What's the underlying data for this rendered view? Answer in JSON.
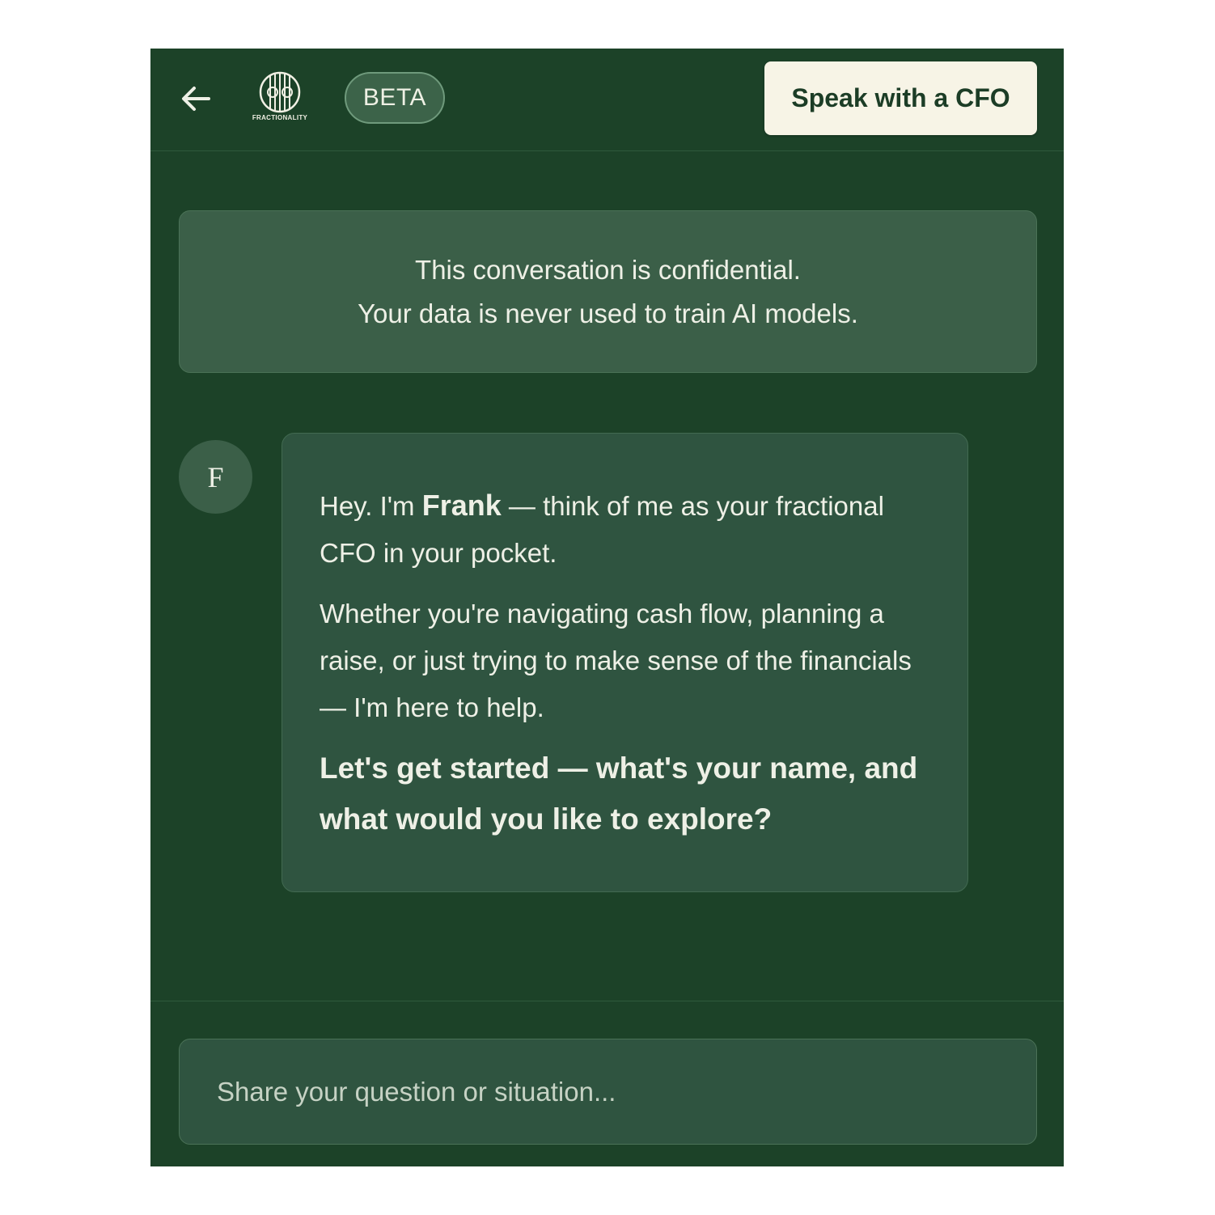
{
  "header": {
    "back_icon": "arrow-left-icon",
    "logo_text": "FRACTIONALITY",
    "badge": "BETA",
    "cta_label": "Speak with a CFO"
  },
  "notice": {
    "line1": "This conversation is confidential.",
    "line2": "Your data is never used to train AI models."
  },
  "message": {
    "avatar_initial": "F",
    "p1_before": "Hey. I'm ",
    "p1_name": "Frank",
    "p1_after": " — think of me as your fractional CFO in your pocket.",
    "p2": "Whether you're navigating cash flow, planning a raise, or just trying to make sense of the financials — I'm here to help.",
    "p3": "Let's get started — what's your name, and what would you like to explore?"
  },
  "composer": {
    "placeholder": "Share your question or situation..."
  },
  "colors": {
    "background": "#1c4228",
    "card": "#3b5f48",
    "bubble": "#2f5440",
    "cta_bg": "#f7f4e6",
    "text": "#eef0e6"
  }
}
